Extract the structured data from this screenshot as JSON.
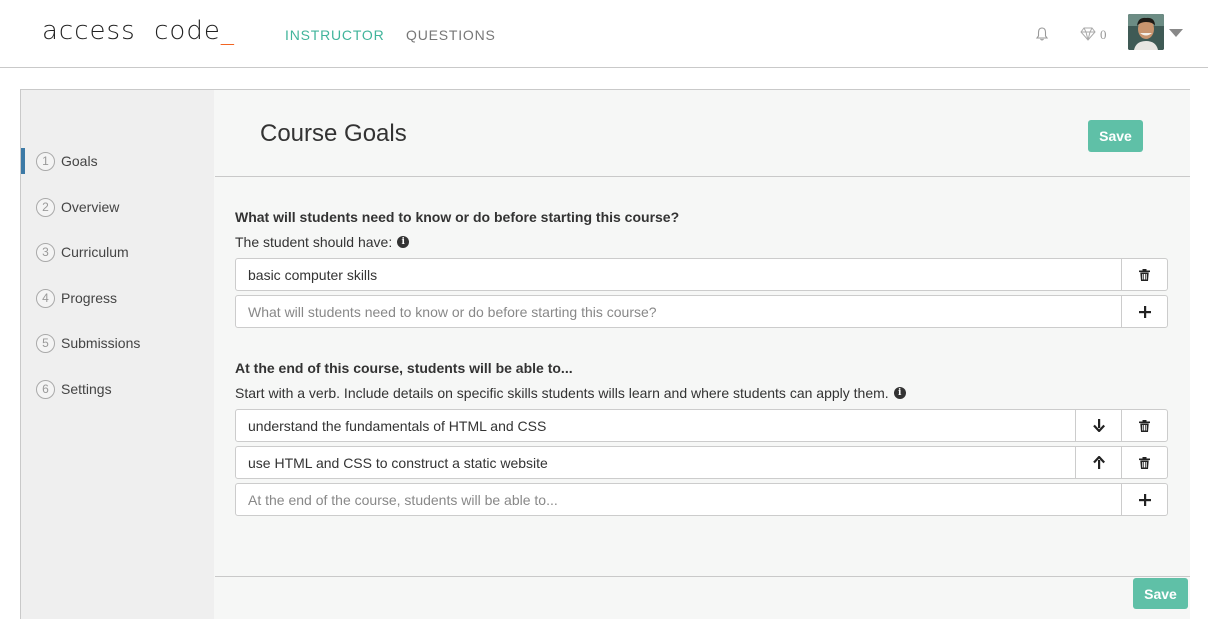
{
  "header": {
    "logo_main": "access  code",
    "logo_cursor": "_",
    "nav": {
      "instructor": "INSTRUCTOR",
      "questions": "QUESTIONS"
    },
    "gem_count": "0",
    "accent_color": "#41b49b"
  },
  "sidebar": {
    "items": [
      {
        "num": "1",
        "label": "Goals"
      },
      {
        "num": "2",
        "label": "Overview"
      },
      {
        "num": "3",
        "label": "Curriculum"
      },
      {
        "num": "4",
        "label": "Progress"
      },
      {
        "num": "5",
        "label": "Submissions"
      },
      {
        "num": "6",
        "label": "Settings"
      }
    ],
    "active_index": 0
  },
  "main": {
    "title": "Course Goals",
    "save_label": "Save",
    "prereq": {
      "title": "What will students need to know or do before starting this course?",
      "hint": "The student should have:",
      "items": [
        "basic computer skills"
      ],
      "new_placeholder": "What will students need to know or do before starting this course?"
    },
    "outcomes": {
      "title": "At the end of this course, students will be able to...",
      "hint": "Start with a verb. Include details on specific skills students wills learn and where students can apply them.",
      "items": [
        "understand the fundamentals of HTML and CSS",
        "use HTML and CSS to construct a static website"
      ],
      "new_placeholder": "At the end of the course, students will be able to..."
    },
    "footer_save_label": "Save"
  }
}
